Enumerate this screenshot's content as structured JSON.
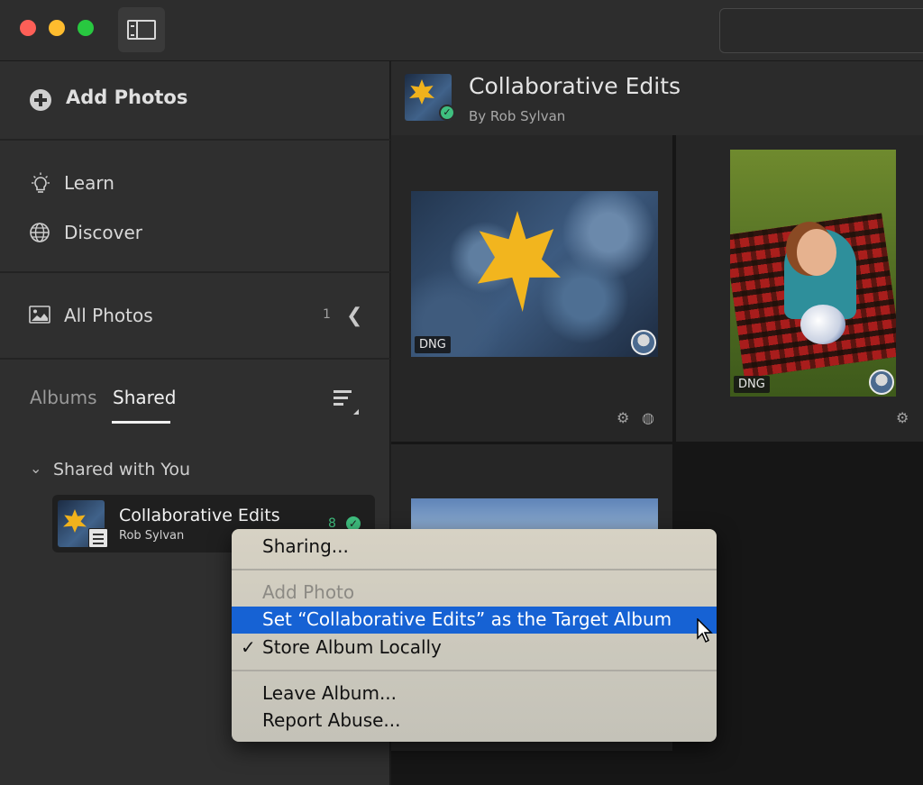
{
  "window": {
    "search_placeholder": ""
  },
  "sidebar": {
    "add_photos": "Add Photos",
    "nav": [
      {
        "label": "Learn",
        "icon": "lightbulb-icon"
      },
      {
        "label": "Discover",
        "icon": "globe-icon"
      }
    ],
    "all_photos": {
      "label": "All Photos",
      "count": "1",
      "icon": "photo-icon"
    },
    "tabs": {
      "albums": "Albums",
      "shared": "Shared",
      "active": "Shared"
    },
    "group": {
      "label": "Shared with You",
      "expanded": true
    },
    "albums": [
      {
        "name": "Collaborative Edits",
        "owner": "Rob Sylvan",
        "count": "8",
        "status": "synced"
      }
    ]
  },
  "main": {
    "album_title": "Collaborative Edits",
    "byline": "By Rob Sylvan",
    "photos": [
      {
        "format": "DNG",
        "subject": "yellow maple leaf on frosted leaves"
      },
      {
        "format": "DNG",
        "subject": "girl lying on red plaid blanket with volleyball"
      },
      {
        "format": "",
        "subject": "blue sky with clouds"
      }
    ]
  },
  "context_menu": {
    "items": [
      {
        "label": "Sharing...",
        "state": "enabled"
      },
      {
        "label": "Add Photo",
        "state": "disabled"
      },
      {
        "label": "Set “Collaborative Edits” as the Target Album",
        "state": "highlighted"
      },
      {
        "label": "Store Album Locally",
        "state": "checked"
      },
      {
        "label": "Leave Album...",
        "state": "enabled"
      },
      {
        "label": "Report Abuse...",
        "state": "enabled"
      }
    ],
    "check_mark": "✓"
  },
  "colors": {
    "accent_green": "#3fbf7f",
    "menu_highlight": "#1662d4",
    "sidebar_bg": "#2f2f2f",
    "main_bg": "#161616"
  }
}
